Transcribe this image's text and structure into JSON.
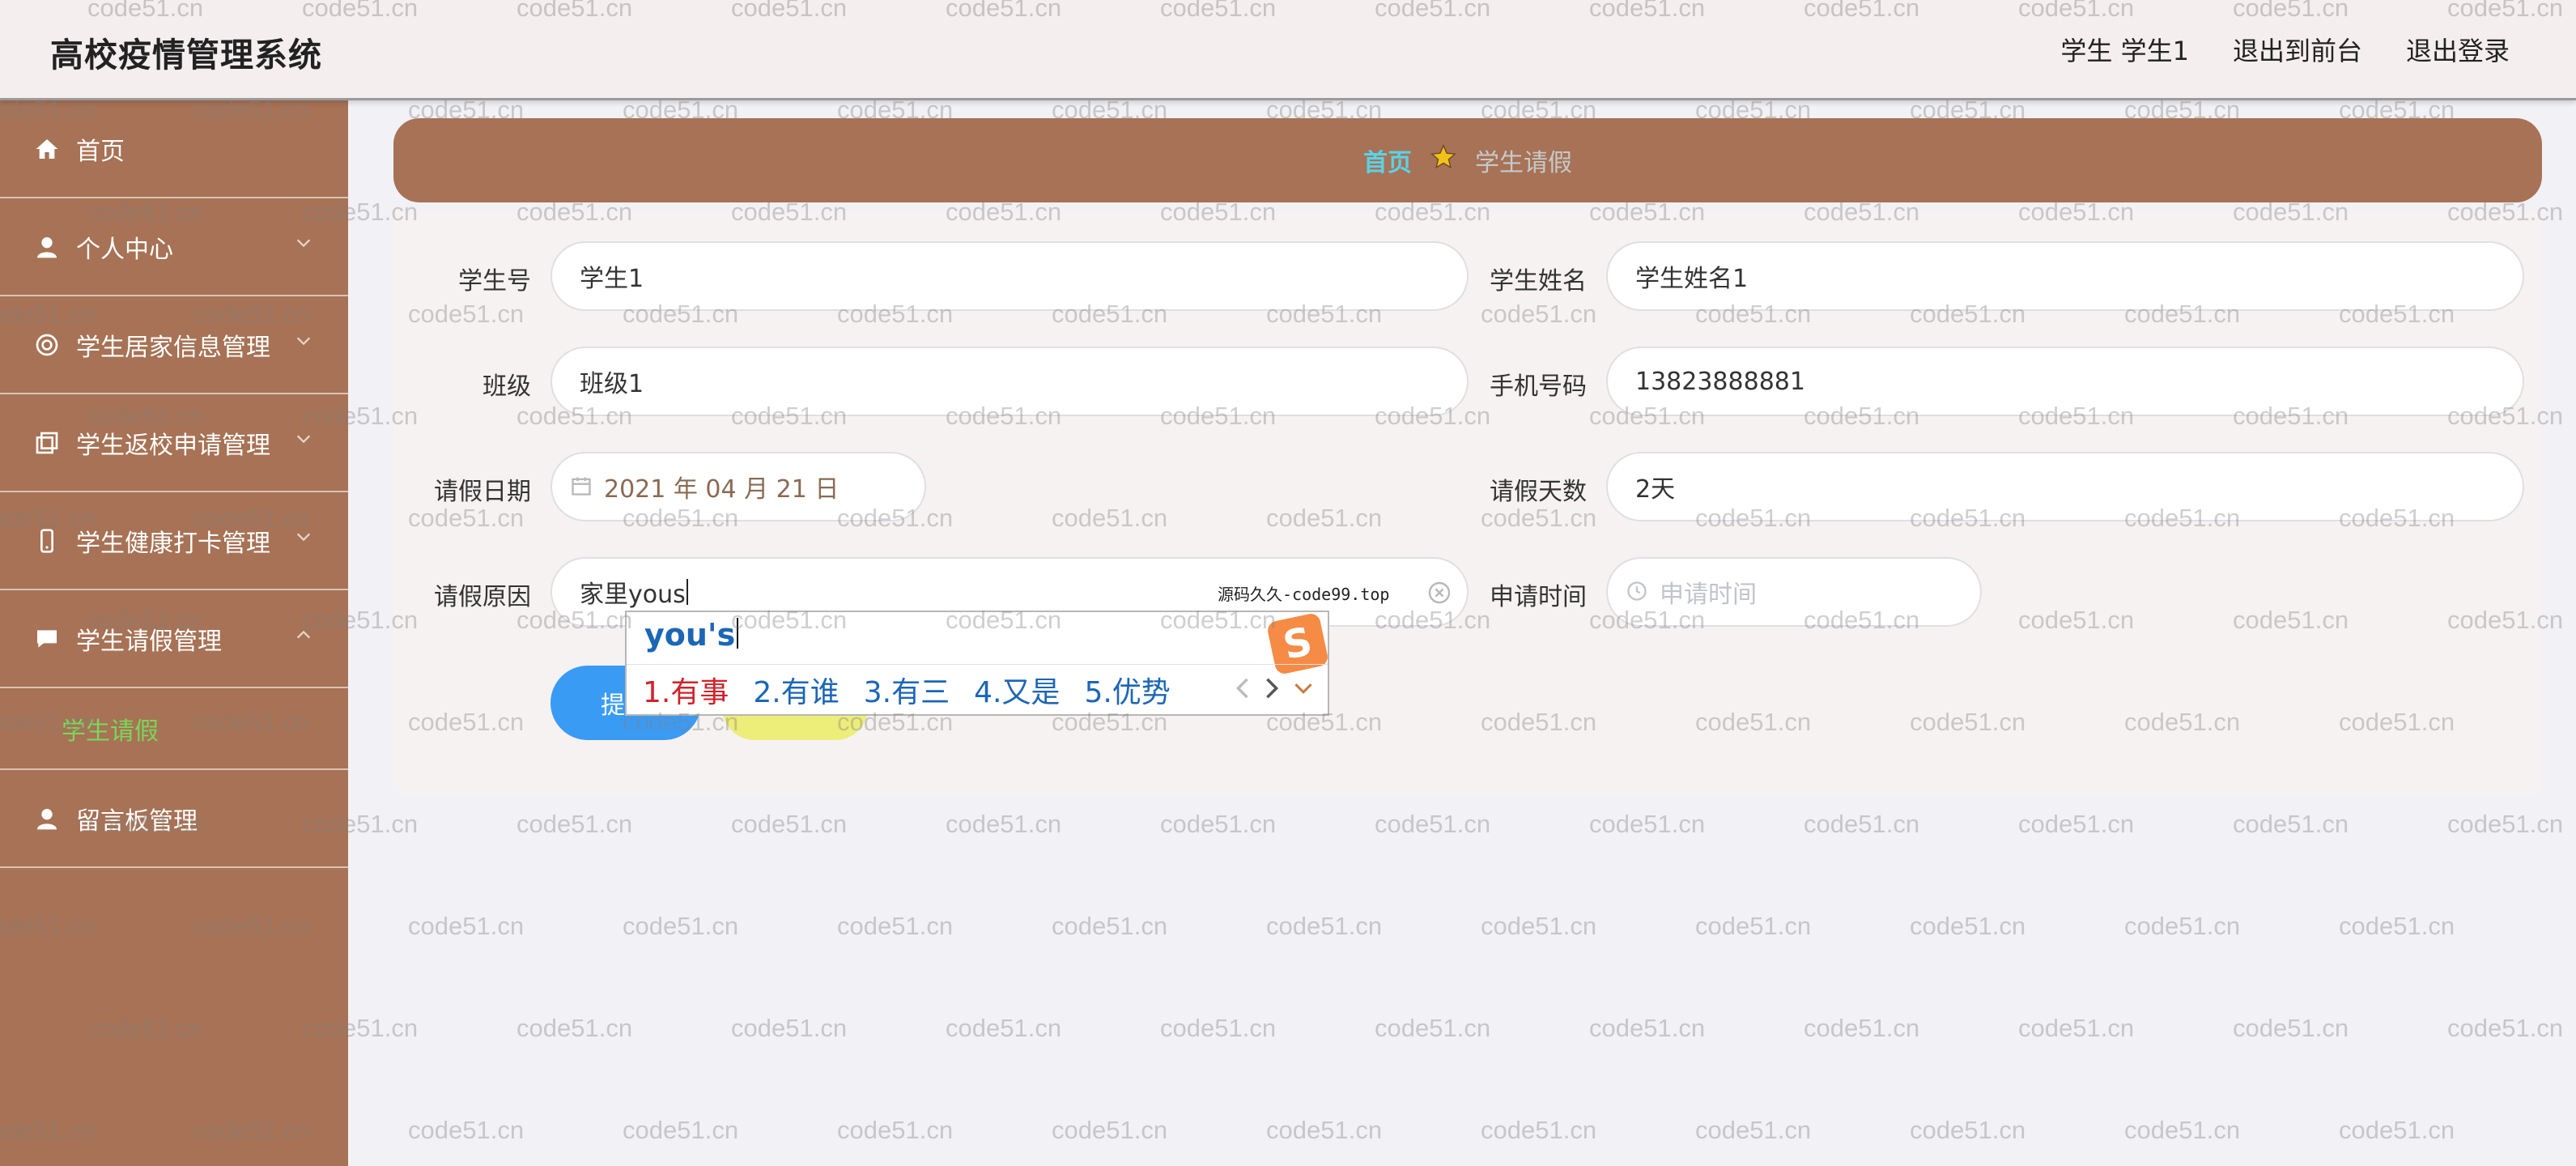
{
  "header": {
    "app_title": "高校疫情管理系统",
    "user_label": "学生 学生1",
    "front_link": "退出到前台",
    "logout_link": "退出登录"
  },
  "sidebar": {
    "items": [
      {
        "label": "首页",
        "icon": "home-icon"
      },
      {
        "label": "个人中心",
        "icon": "user-icon"
      },
      {
        "label": "学生居家信息管理",
        "icon": "circle-icon"
      },
      {
        "label": "学生返校申请管理",
        "icon": "copy-icon"
      },
      {
        "label": "学生健康打卡管理",
        "icon": "phone-icon"
      },
      {
        "label": "学生请假管理",
        "icon": "chat-icon"
      },
      {
        "label": "留言板管理",
        "icon": "user-icon"
      }
    ],
    "active_sub": "学生请假"
  },
  "breadcrumb": {
    "home": "首页",
    "current": "学生请假"
  },
  "form": {
    "student_no": {
      "label": "学生号",
      "value": "学生1"
    },
    "student_name": {
      "label": "学生姓名",
      "value": "学生姓名1"
    },
    "class": {
      "label": "班级",
      "value": "班级1"
    },
    "phone": {
      "label": "手机号码",
      "value": "13823888881"
    },
    "leave_date": {
      "label": "请假日期",
      "value": "2021 年 04 月 21 日"
    },
    "leave_days": {
      "label": "请假天数",
      "value": "2天"
    },
    "leave_reason": {
      "label": "请假原因",
      "value": "家里yous"
    },
    "apply_time": {
      "label": "申请时间",
      "placeholder": "申请时间"
    },
    "submit_partial": "提"
  },
  "ime": {
    "composition": "you's",
    "candidates": [
      "1.有事",
      "2.有谁",
      "3.有三",
      "4.又是",
      "5.优势"
    ],
    "logo": "S",
    "hint": "源码久久-code99.top"
  },
  "watermark": "code51.cn",
  "colors": {
    "sidebar_bg": "#a77255",
    "header_bg": "#f4eeee",
    "active_sub": "#7bd65a",
    "crumb_home": "#5ad2e6",
    "submit_bg": "#3a9bf5",
    "cancel_bg": "#eded7a"
  }
}
